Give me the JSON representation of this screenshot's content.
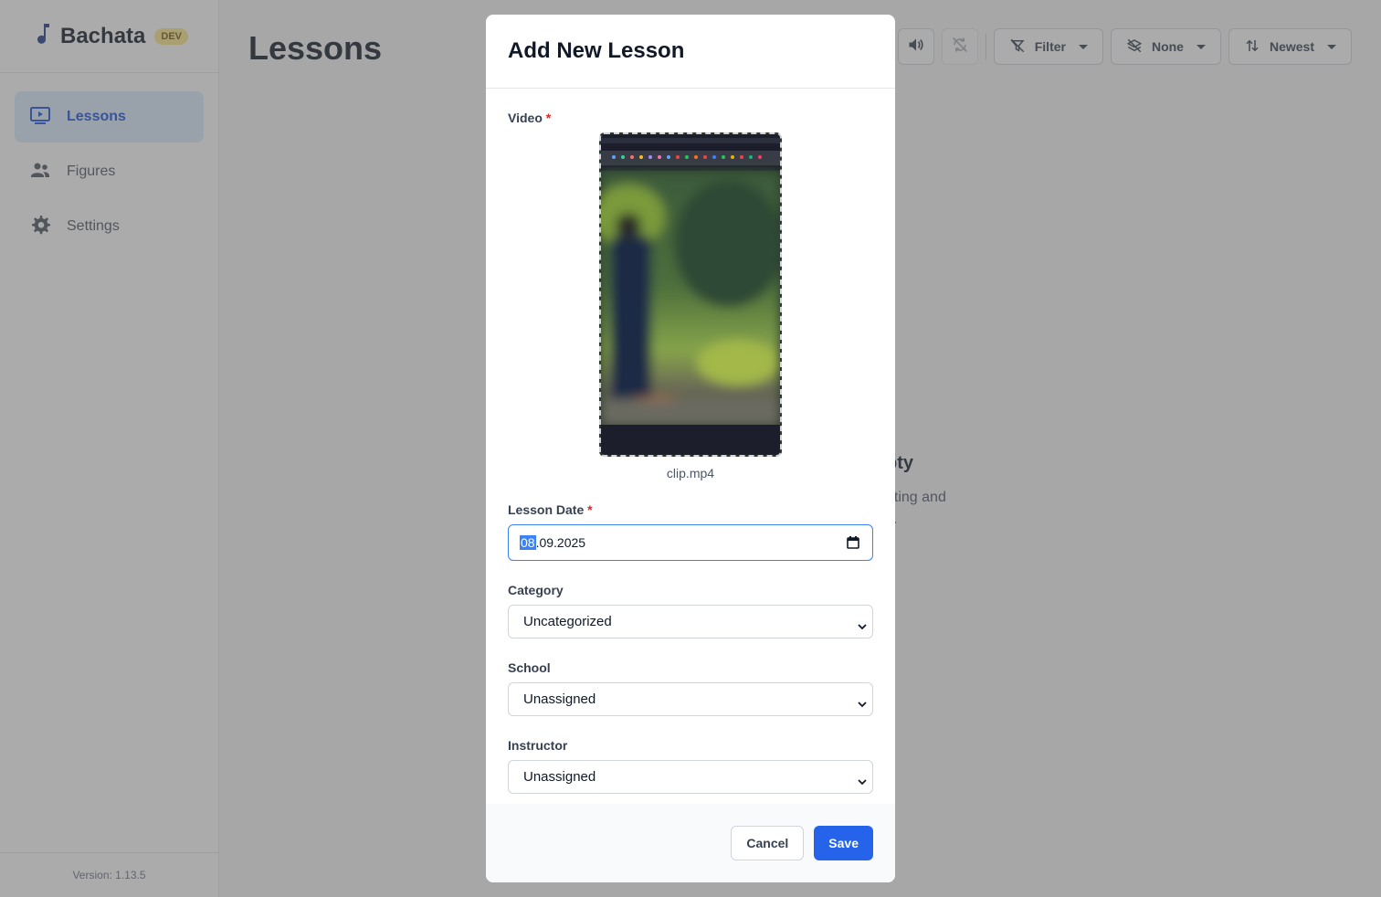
{
  "sidebar": {
    "brand": "Bachata",
    "badge": "DEV",
    "items": [
      {
        "label": "Lessons",
        "icon": "play-screen-icon",
        "active": true
      },
      {
        "label": "Figures",
        "icon": "people-icon",
        "active": false
      },
      {
        "label": "Settings",
        "icon": "gear-icon",
        "active": false
      }
    ],
    "version": "Version: 1.13.5"
  },
  "main": {
    "title": "Lessons",
    "toolbar": {
      "volume_icon": "volume-icon",
      "sync_icon": "sync-off-icon",
      "filter_label": "Filter",
      "group_label": "None",
      "sort_label": "Newest"
    },
    "empty_title_visible": "pty",
    "empty_text_line1": "ating and",
    "empty_text_line2": "s."
  },
  "modal": {
    "title": "Add New Lesson",
    "video_label": "Video",
    "required_mark": "*",
    "video_filename": "clip.mp4",
    "date_label": "Lesson Date",
    "date_day": "08",
    "date_rest": ".09.2025",
    "category_label": "Category",
    "category_value": "Uncategorized",
    "school_label": "School",
    "school_value": "Unassigned",
    "instructor_label": "Instructor",
    "instructor_value": "Unassigned",
    "cancel_label": "Cancel",
    "save_label": "Save"
  },
  "colors": {
    "accent": "#2563eb",
    "active_nav_bg": "#dbeafe",
    "overlay": "rgba(88,88,88,0.5)"
  }
}
